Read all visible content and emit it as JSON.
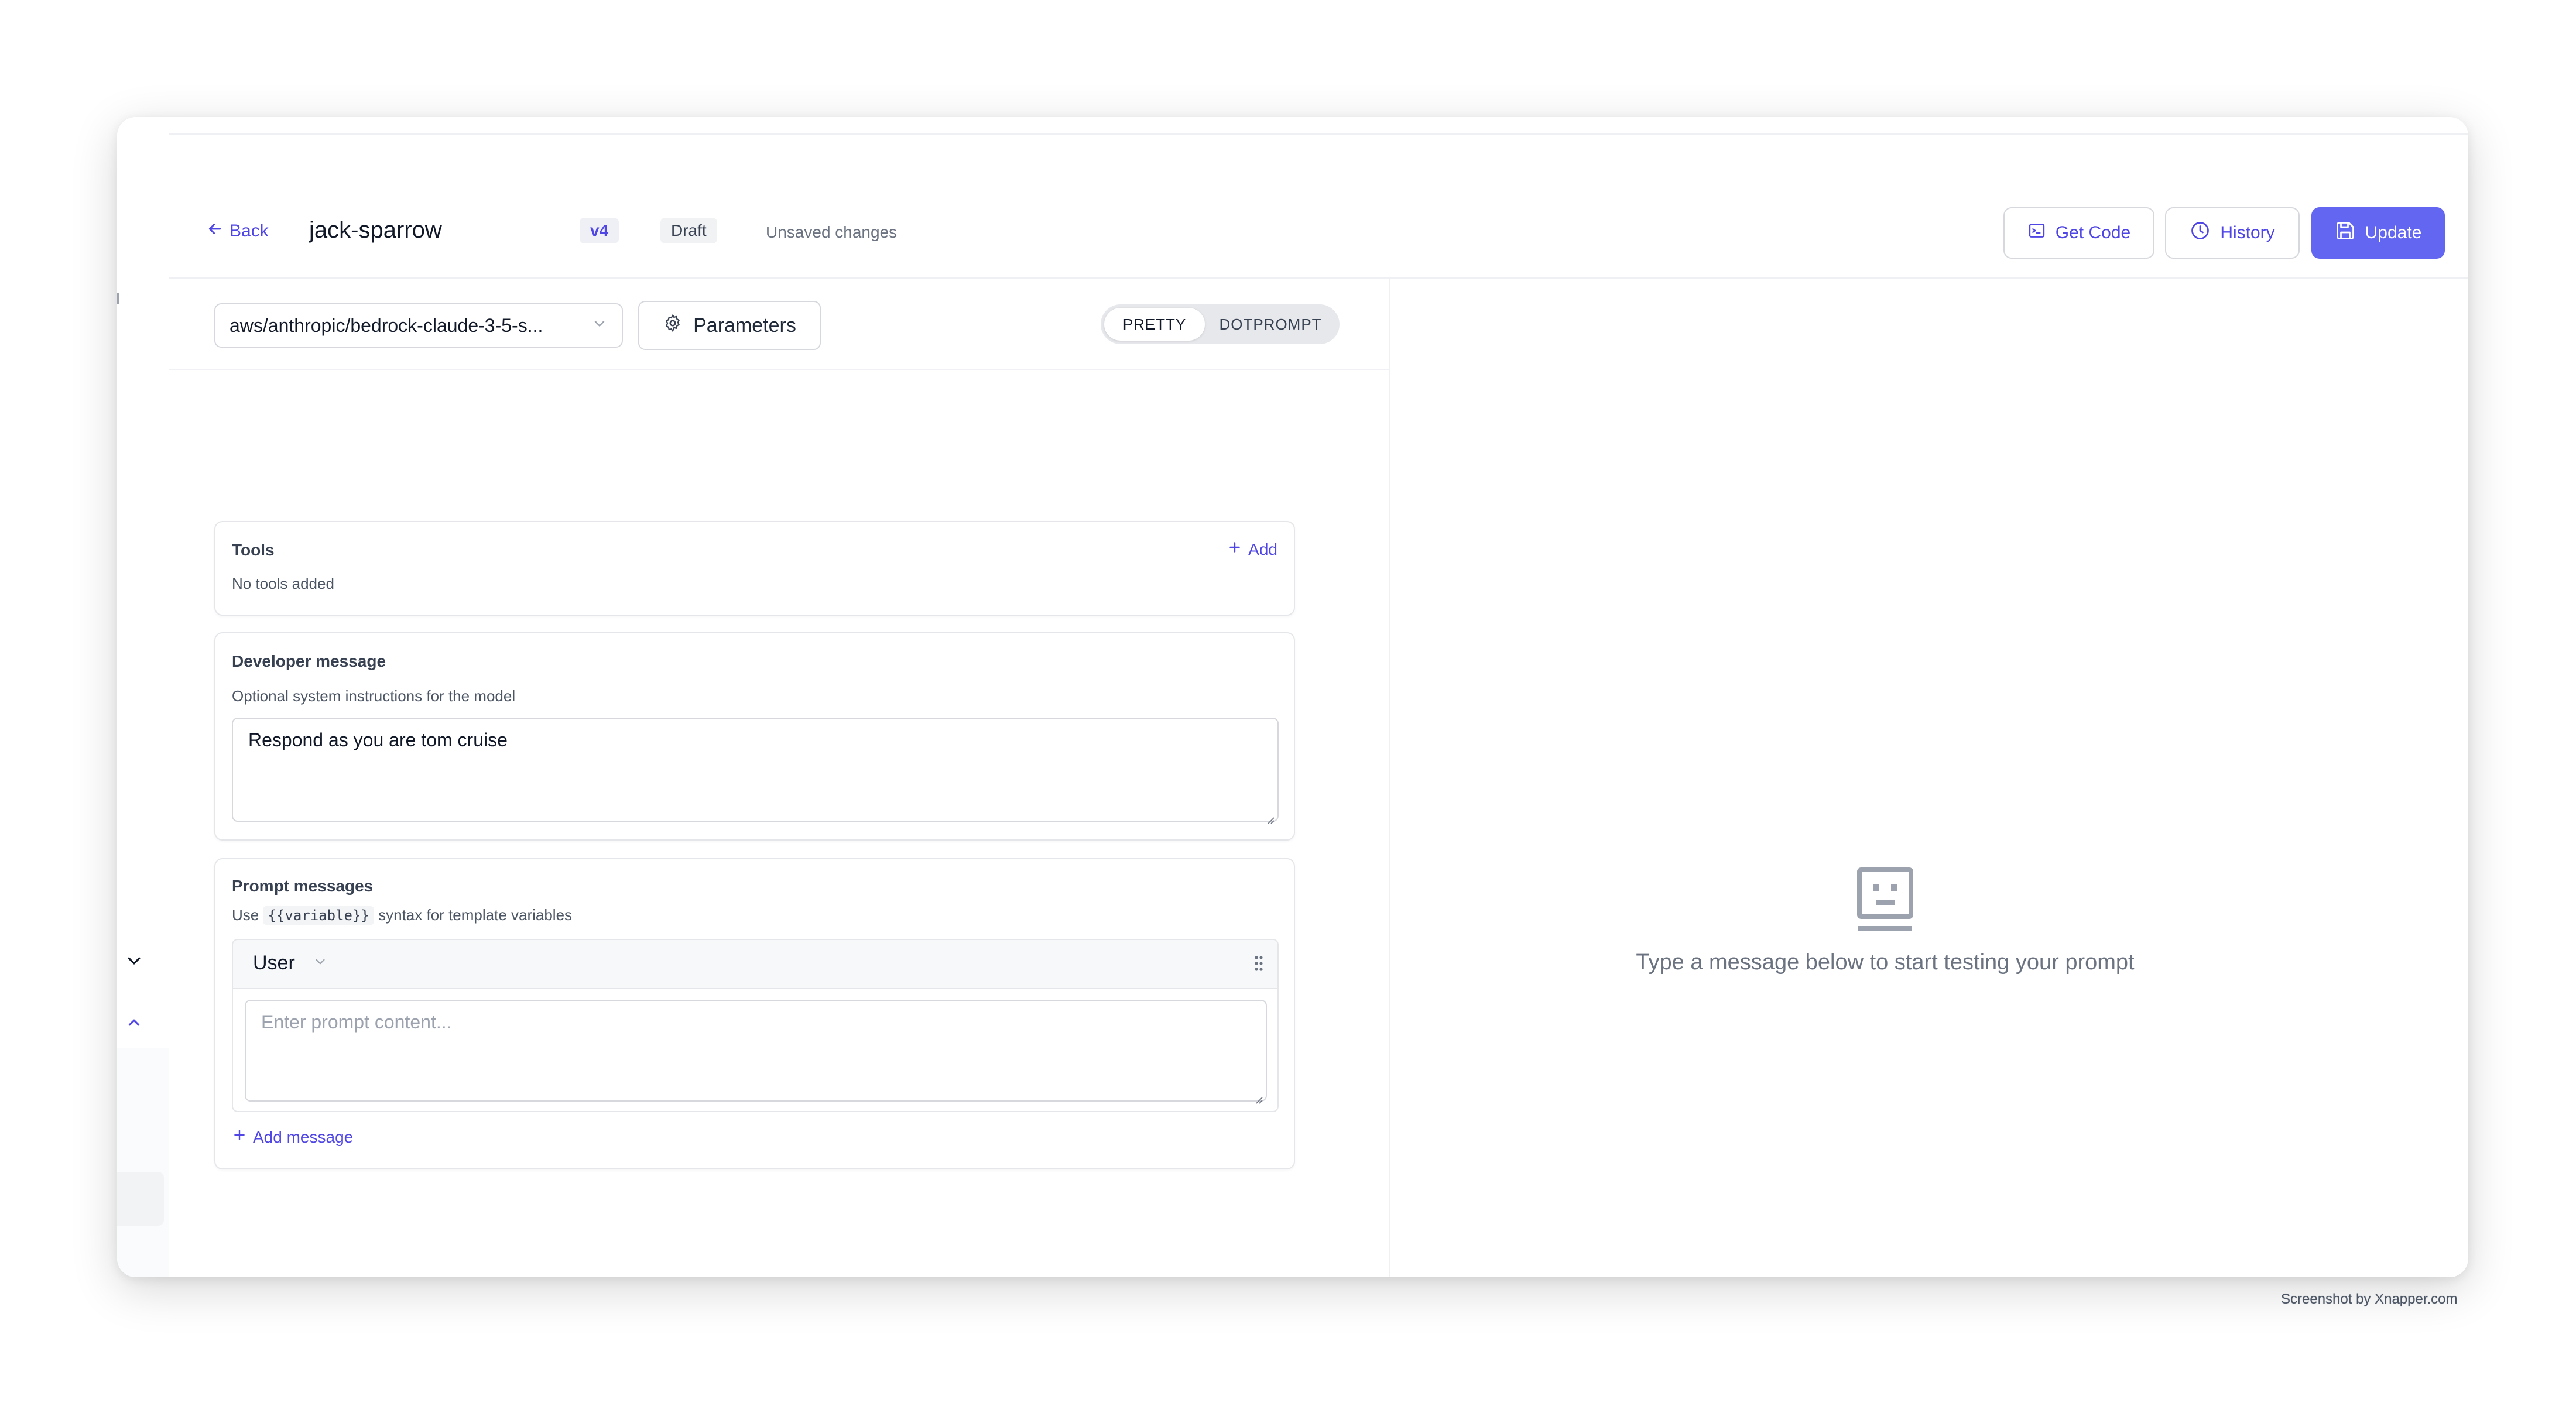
{
  "header": {
    "back_label": "Back",
    "title": "jack-sparrow",
    "version_badge": "v4",
    "status_badge": "Draft",
    "unsaved_text": "Unsaved changes",
    "get_code_label": "Get Code",
    "history_label": "History",
    "update_label": "Update"
  },
  "toolbar": {
    "model_value": "aws/anthropic/bedrock-claude-3-5-s...",
    "parameters_label": "Parameters",
    "view_modes": [
      "PRETTY",
      "DOTPROMPT"
    ],
    "active_view_mode": "PRETTY"
  },
  "tools": {
    "title": "Tools",
    "add_label": "Add",
    "empty_text": "No tools added"
  },
  "developer_message": {
    "title": "Developer message",
    "subtitle": "Optional system instructions for the model",
    "value": "Respond as you are tom cruise"
  },
  "prompt_messages": {
    "title": "Prompt messages",
    "hint_prefix": "Use",
    "hint_code": "{{variable}}",
    "hint_suffix": "syntax for template variables",
    "messages": [
      {
        "role": "User",
        "content": "",
        "placeholder": "Enter prompt content..."
      }
    ],
    "add_message_label": "Add message"
  },
  "preview": {
    "empty_text": "Type a message below to start testing your prompt"
  },
  "watermark": "Screenshot by Xnapper.com",
  "colors": {
    "accent": "#4f46e5",
    "primary_button": "#6366f1",
    "border": "#d6d8de",
    "muted_text": "#6b7280"
  },
  "icons": [
    "arrow-left-icon",
    "terminal-icon",
    "clock-icon",
    "save-icon",
    "chevron-down-icon",
    "gear-icon",
    "plus-icon",
    "drag-handle-icon",
    "robot-face-icon",
    "chevron-up-icon"
  ]
}
